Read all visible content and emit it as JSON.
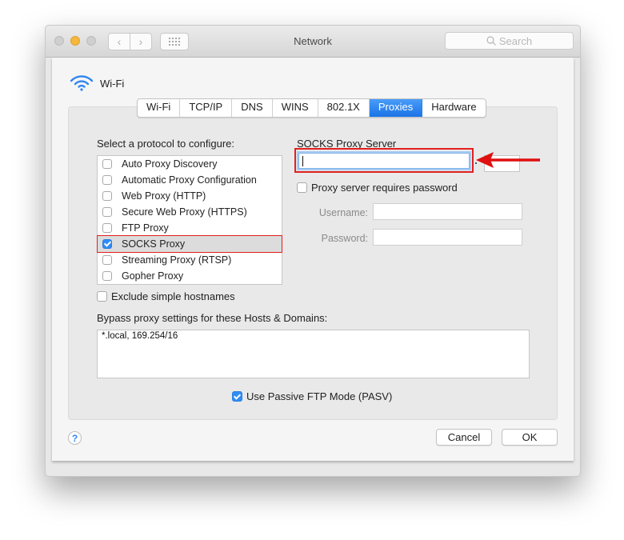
{
  "window": {
    "title": "Network",
    "search_placeholder": "Search",
    "nav_back_glyph": "‹",
    "nav_forward_glyph": "›"
  },
  "interface": {
    "name": "Wi-Fi",
    "icon": "wifi-icon"
  },
  "tabs": [
    {
      "label": "Wi-Fi",
      "active": false
    },
    {
      "label": "TCP/IP",
      "active": false
    },
    {
      "label": "DNS",
      "active": false
    },
    {
      "label": "WINS",
      "active": false
    },
    {
      "label": "802.1X",
      "active": false
    },
    {
      "label": "Proxies",
      "active": true
    },
    {
      "label": "Hardware",
      "active": false
    }
  ],
  "protocols": {
    "heading": "Select a protocol to configure:",
    "items": [
      {
        "label": "Auto Proxy Discovery",
        "checked": false
      },
      {
        "label": "Automatic Proxy Configuration",
        "checked": false
      },
      {
        "label": "Web Proxy (HTTP)",
        "checked": false
      },
      {
        "label": "Secure Web Proxy (HTTPS)",
        "checked": false
      },
      {
        "label": "FTP Proxy",
        "checked": false
      },
      {
        "label": "SOCKS Proxy",
        "checked": true,
        "selected": true
      },
      {
        "label": "Streaming Proxy (RTSP)",
        "checked": false
      },
      {
        "label": "Gopher Proxy",
        "checked": false
      }
    ]
  },
  "server": {
    "heading": "SOCKS Proxy Server",
    "host_value": "",
    "port_value": "",
    "requires_password_label": "Proxy server requires password",
    "requires_password": false,
    "username_label": "Username:",
    "username_value": "",
    "password_label": "Password:",
    "password_value": ""
  },
  "exclude_simple": {
    "label": "Exclude simple hostnames",
    "checked": false
  },
  "bypass": {
    "label": "Bypass proxy settings for these Hosts & Domains:",
    "value": "*.local, 169.254/16"
  },
  "passive_ftp": {
    "label": "Use Passive FTP Mode (PASV)",
    "checked": true
  },
  "buttons": {
    "help": "?",
    "cancel": "Cancel",
    "ok": "OK"
  },
  "annotation": {
    "highlight_color": "#e02020",
    "arrow_color": "#e01010"
  }
}
